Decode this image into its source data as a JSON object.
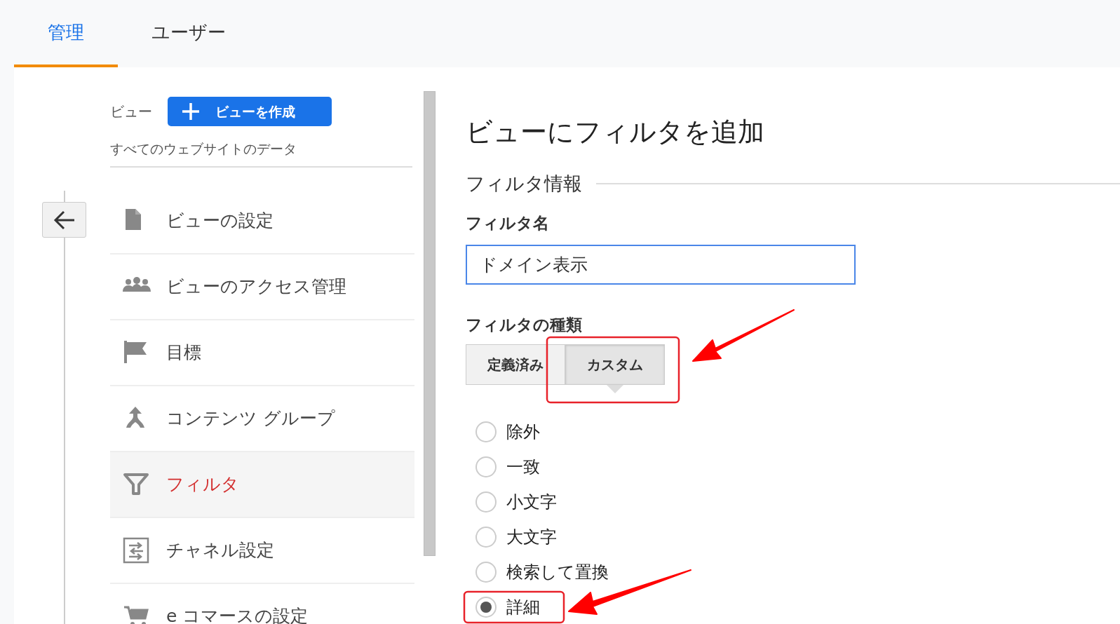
{
  "tabs": [
    {
      "label": "管理",
      "selected": true
    },
    {
      "label": "ユーザー",
      "selected": false
    }
  ],
  "sidebar": {
    "view_label": "ビュー",
    "create_button": "ビューを作成",
    "view_name": "すべてのウェブサイトのデータ",
    "items": [
      {
        "kind": "document",
        "label": "ビューの設定",
        "selected": false
      },
      {
        "kind": "people",
        "label": "ビューのアクセス管理",
        "selected": false
      },
      {
        "kind": "flag",
        "label": "目標",
        "selected": false
      },
      {
        "kind": "merge",
        "label": "コンテンツ グループ",
        "selected": false
      },
      {
        "kind": "filter",
        "label": "フィルタ",
        "selected": true
      },
      {
        "kind": "channel",
        "label": "チャネル設定",
        "selected": false
      },
      {
        "kind": "cart",
        "label": "e コマースの設定",
        "selected": false
      }
    ]
  },
  "form": {
    "title": "ビューにフィルタを追加",
    "section": "フィルタ情報",
    "name_label": "フィルタ名",
    "name_value": "ドメイン表示",
    "type_label": "フィルタの種類",
    "type_buttons": [
      {
        "label": "定義済み",
        "selected": false
      },
      {
        "label": "カスタム",
        "selected": true
      }
    ],
    "options": [
      {
        "label": "除外",
        "selected": false
      },
      {
        "label": "一致",
        "selected": false
      },
      {
        "label": "小文字",
        "selected": false
      },
      {
        "label": "大文字",
        "selected": false
      },
      {
        "label": "検索して置換",
        "selected": false
      },
      {
        "label": "詳細",
        "selected": true
      }
    ]
  }
}
